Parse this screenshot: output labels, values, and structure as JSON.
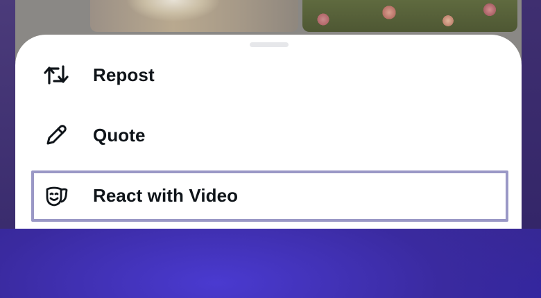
{
  "menu": {
    "items": [
      {
        "label": "Repost",
        "icon": "repost-icon"
      },
      {
        "label": "Quote",
        "icon": "pencil-icon"
      },
      {
        "label": "React with Video",
        "icon": "face-mask-icon"
      }
    ],
    "highlighted_index": 2
  },
  "colors": {
    "sheet_background": "#ffffff",
    "text": "#0f1419",
    "highlight_border": "#9a98c6",
    "handle": "#e6e7ea"
  }
}
